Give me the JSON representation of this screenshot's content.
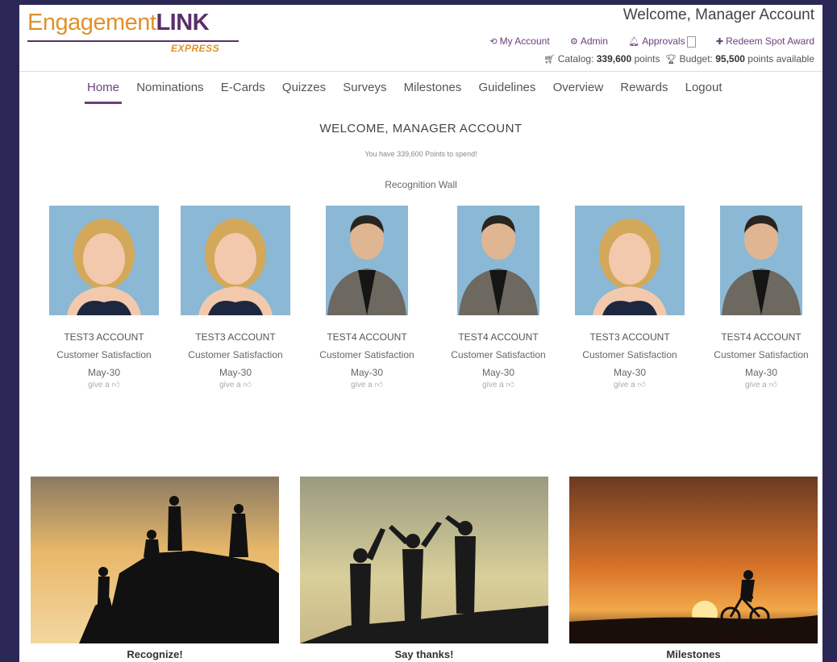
{
  "brand": {
    "logo_main": "Engagement",
    "logo_link": "LINK",
    "logo_sub": "EXPRESS"
  },
  "header": {
    "welcome": "Welcome, Manager Account",
    "links": [
      {
        "icon": "refresh-icon",
        "label": "My Account"
      },
      {
        "icon": "gear-icon",
        "label": "Admin"
      },
      {
        "icon": "bell-icon",
        "label": "Approvals"
      },
      {
        "icon": "plus-icon",
        "label": "Redeem Spot Award"
      }
    ],
    "catalog_label": "Catalog:",
    "catalog_value": "339,600",
    "catalog_unit": "points",
    "budget_label": "Budget:",
    "budget_value": "95,500",
    "budget_unit": "points available"
  },
  "nav": [
    "Home",
    "Nominations",
    "E-Cards",
    "Quizzes",
    "Surveys",
    "Milestones",
    "Guidelines",
    "Overview",
    "Rewards",
    "Logout"
  ],
  "main": {
    "heading": "WELCOME, MANAGER ACCOUNT",
    "points_text": "You have 339,600 Points to spend!",
    "wall_title": "Recognition Wall"
  },
  "cards": [
    {
      "name": "TEST3 ACCOUNT",
      "dept": "Customer Satisfaction",
      "date": "May-30",
      "give": "give a"
    },
    {
      "name": "TEST3 ACCOUNT",
      "dept": "Customer Satisfaction",
      "date": "May-30",
      "give": "give a"
    },
    {
      "name": "TEST4 ACCOUNT",
      "dept": "Customer Satisfaction",
      "date": "May-30",
      "give": "give a"
    },
    {
      "name": "TEST4 ACCOUNT",
      "dept": "Customer Satisfaction",
      "date": "May-30",
      "give": "give a"
    },
    {
      "name": "TEST3 ACCOUNT",
      "dept": "Customer Satisfaction",
      "date": "May-30",
      "give": "give a"
    },
    {
      "name": "TEST4 ACCOUNT",
      "dept": "Customer Satisfaction",
      "date": "May-30",
      "give": "give a"
    }
  ],
  "banners": [
    {
      "caption": "Recognize!"
    },
    {
      "caption": "Say thanks!"
    },
    {
      "caption": "Milestones"
    }
  ],
  "colors": {
    "brand_purple": "#6b3f7f",
    "brand_orange": "#e0912b",
    "page_bg": "#2b2856"
  }
}
